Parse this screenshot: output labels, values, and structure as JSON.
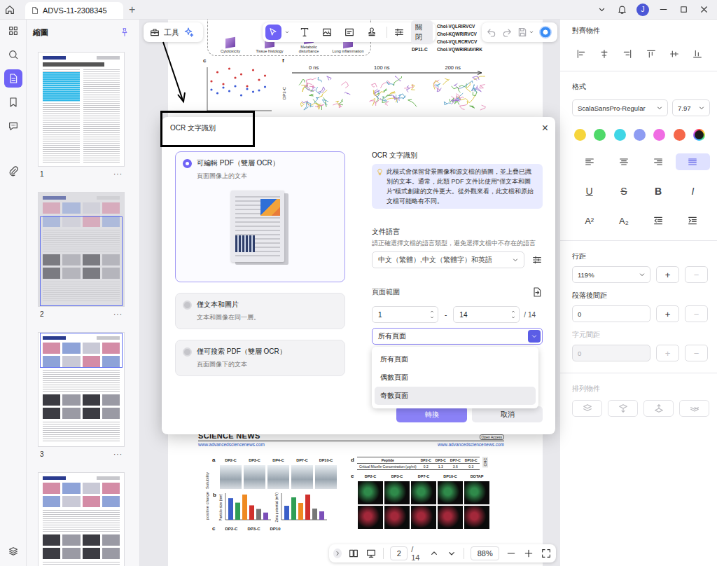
{
  "topbar": {
    "tab_title": "ADVS-11-2308345",
    "new_tab": "+",
    "avatar": "J"
  },
  "rail": [
    {
      "selected": false
    },
    {
      "selected": false
    },
    {
      "selected": true
    },
    {
      "selected": false
    },
    {
      "selected": false
    },
    {
      "selected": false
    },
    {
      "selected": false
    }
  ],
  "thumbnails": {
    "title": "縮圖",
    "pages": [
      {
        "number": "1",
        "more": "···",
        "kind": "text",
        "selected": false,
        "view_start": 0,
        "view_end": 0
      },
      {
        "number": "2",
        "more": "···",
        "kind": "figure",
        "selected": true,
        "view_start": 0.21,
        "view_end": 1
      },
      {
        "number": "3",
        "more": "···",
        "kind": "figure",
        "selected": false,
        "view_start": 0,
        "view_end": 0.31
      },
      {
        "number": "",
        "more": "",
        "kind": "figure",
        "selected": false,
        "view_start": 0,
        "view_end": 0
      }
    ]
  },
  "toolbar": {
    "tools_label": "工具",
    "tools": [
      {
        "selected": true
      },
      {
        "selected": false
      },
      {
        "selected": false
      },
      {
        "selected": false
      },
      {
        "selected": false
      }
    ],
    "close_label": "關閉"
  },
  "document": {
    "page2": {
      "schematic_labels": [
        "Cytotoxicity",
        "Tissue histology",
        "Metabolic disturbance",
        "Lung inflammation"
      ],
      "peptides": [
        {
          "name": "",
          "seq": "Chol-VQLRIRVCV"
        },
        {
          "name": "",
          "seq": "Chol-KQWRIRVCV"
        },
        {
          "name": "",
          "seq": "Chol-VQLRCRVCV"
        },
        {
          "name": "DP11-C",
          "seq": "Chol-VQWRIRIAVIRK"
        }
      ],
      "panel_c": {
        "letter": "c",
        "series": [
          {
            "color": "#d23a3a",
            "values": [
              42,
              55,
              38,
              60,
              47,
              52,
              35,
              58,
              44,
              50
            ]
          },
          {
            "color": "#3b5bd6",
            "values": [
              30,
              25,
              33,
              28,
              35,
              22,
              31,
              27,
              29,
              34
            ]
          }
        ]
      },
      "panel_f": {
        "letter": "f",
        "times": [
          "0 ns",
          "100 ns",
          "200 ns"
        ],
        "label": "DP3-C"
      }
    },
    "page3": {
      "journal": "SCIENCE NEWS",
      "badge": "Open Access",
      "url_left": "www.advancedsciencenews.com",
      "url_right": "www.advancedsciencenews.com",
      "panel_a": {
        "letter": "a",
        "side": "Solubility",
        "tubes": [
          "DP2-C",
          "DP3-C",
          "DP4-C",
          "DP7-C",
          "DP10-C"
        ]
      },
      "panel_b": {
        "letter": "b",
        "side": "positive charge",
        "charts": [
          {
            "axis": "Particle size (nm)",
            "bars": [
              {
                "value": 120,
                "color": "#3a5fc8"
              },
              {
                "value": 95,
                "color": "#2f9e55"
              },
              {
                "value": 140,
                "color": "#ef8a22"
              },
              {
                "value": 80,
                "color": "#d0312d"
              },
              {
                "value": 60,
                "color": "#777777"
              },
              {
                "value": 40,
                "color": "#7b4fb8"
              }
            ]
          },
          {
            "axis": "Zeta potential (mV)",
            "bars": [
              {
                "value": 25,
                "color": "#3a5fc8"
              },
              {
                "value": 40,
                "color": "#2f9e55"
              },
              {
                "value": 30,
                "color": "#ef8a22"
              },
              {
                "value": 45,
                "color": "#d0312d"
              },
              {
                "value": 20,
                "color": "#777777"
              },
              {
                "value": 15,
                "color": "#7b4fb8"
              }
            ]
          }
        ]
      },
      "panel_c": {
        "letter": "c",
        "labels": [
          "DP2-C",
          "DP3-C",
          "DP10"
        ]
      },
      "panel_d": {
        "letter": "d",
        "header": [
          "Peptide",
          "DP2-C",
          "DP3-C",
          "DP7-C",
          "DP10-C"
        ],
        "row": [
          "Critical Micelle Concentration (μg/ml)",
          "0.2",
          "1.3",
          "3.6",
          "0.3"
        ],
        "side": "CMC"
      },
      "panel_e": {
        "letter": "e",
        "columns": [
          "DP2-C",
          "DP3-C",
          "DP7-C",
          "DP10-C",
          "DOTAP"
        ],
        "rows": [
          {
            "color": "#2f8a4a"
          },
          {
            "color": "#a3283a"
          }
        ]
      }
    }
  },
  "page_nav": {
    "current": "2",
    "total": "/ 14",
    "zoom": "88%"
  },
  "properties": {
    "align_title": "對齊物件",
    "format_title": "格式",
    "font": "ScalaSansPro-Regular",
    "size": "7.97",
    "colors": [
      {
        "color": "#f6d53b",
        "selected": false
      },
      {
        "color": "#4fd96a",
        "selected": false
      },
      {
        "color": "#3fd6e6",
        "selected": false
      },
      {
        "color": "#8e9cf2",
        "selected": false
      },
      {
        "color": "#f06ce3",
        "selected": false
      },
      {
        "color": "#f5674a",
        "selected": false
      },
      {
        "color": "#1b1b1b",
        "selected": true
      }
    ],
    "text_align": [
      {
        "selected": false
      },
      {
        "selected": false
      },
      {
        "selected": false
      },
      {
        "selected": true
      }
    ],
    "styles": [
      {
        "label": "U",
        "kind": "underline"
      },
      {
        "label": "S",
        "kind": "strike"
      },
      {
        "label": "B",
        "kind": "bold"
      },
      {
        "label": "I",
        "kind": "italic"
      }
    ],
    "scripts": [
      "A²",
      "A₂"
    ],
    "line_spacing": {
      "label": "行距",
      "value": "119%",
      "minus_disabled": true
    },
    "para_spacing": {
      "label": "段落後間距",
      "value": "0",
      "minus_disabled": true
    },
    "char_spacing": {
      "label": "字元間距",
      "value": "0",
      "disabled": true
    },
    "arrange_title": "排列物件",
    "arrange_disabled": true,
    "plus": "+",
    "minus": "−"
  },
  "dialog": {
    "title": "OCR 文字識別",
    "close": "×",
    "modes": [
      {
        "label": "可編輯 PDF（雙層 OCR）",
        "desc": "頁面圖像上的文本",
        "selected": true
      },
      {
        "label": "僅文本和圖片",
        "desc": "文本和圖像在同一層。",
        "selected": false
      },
      {
        "label": "僅可搜索 PDF（雙層 OCR）",
        "desc": "頁面圖像下的文本",
        "selected": false
      }
    ],
    "heading": "OCR 文字識別",
    "info": "此模式會保留背景圖像和源文檔的插圖，並上疊已識別的文本。通常，此類 PDF 文件比使用\"僅文本和圖片\"模式創建的文件更大。從外觀來看，此文檔和原始文檔可能略有不同。",
    "language_label": "文件語言",
    "language_hint": "請正確選擇文檔的語言類型，避免選擇文檔中不存在的語言",
    "language_value": "中文（繁體）,中文（繁體字）和英語",
    "range_label": "頁面範圍",
    "from": "1",
    "dash": "-",
    "to": "14",
    "total": "/ 14",
    "subset": {
      "value": "所有頁面",
      "open": true,
      "options": [
        {
          "label": "所有頁面",
          "hover": false
        },
        {
          "label": "偶數頁面",
          "hover": false
        },
        {
          "label": "奇數頁面",
          "hover": true
        }
      ]
    },
    "convert": "轉換",
    "cancel": "取消"
  },
  "annotation": {
    "highlight_box": true,
    "arrow": true
  }
}
